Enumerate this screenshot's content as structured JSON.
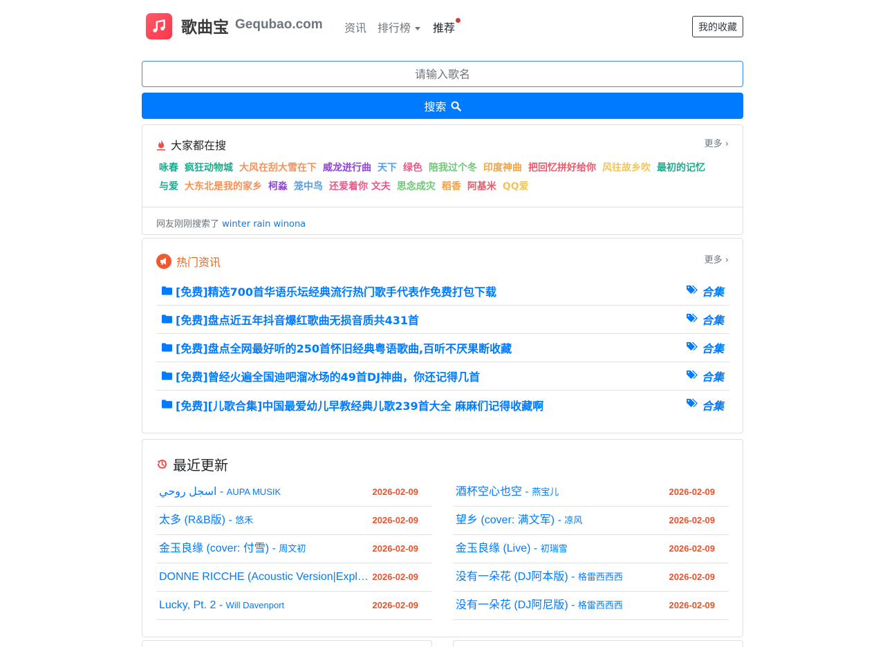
{
  "header": {
    "brand_cn": "歌曲宝",
    "brand_en": "Gequbao.com",
    "nav": {
      "news": "资讯",
      "rank": "排行榜",
      "recommend": "推荐"
    },
    "favorites": "我的收藏"
  },
  "search": {
    "placeholder": "请输入歌名",
    "button": "搜索"
  },
  "hot": {
    "title": "大家都在搜",
    "more": "更多",
    "tags": [
      {
        "text": "咏春",
        "color": "#20a98b"
      },
      {
        "text": "疯狂动物城",
        "color": "#20a98b"
      },
      {
        "text": "大风在刮大雪在下",
        "color": "#f3935a"
      },
      {
        "text": "威龙进行曲",
        "color": "#8e44d6"
      },
      {
        "text": "天下",
        "color": "#5a9ee0"
      },
      {
        "text": "绿色",
        "color": "#ea5a87"
      },
      {
        "text": "陪我过个冬",
        "color": "#6fc777"
      },
      {
        "text": "印度神曲",
        "color": "#f5a142"
      },
      {
        "text": "把回忆拼好给你",
        "color": "#ea5a6b"
      },
      {
        "text": "风往故乡吹",
        "color": "#f3c45a"
      },
      {
        "text": "最初的记忆",
        "color": "#20a98b"
      },
      {
        "text": "与爱",
        "color": "#20a98b"
      },
      {
        "text": "大东北是我的家乡",
        "color": "#f3935a"
      },
      {
        "text": "柯淼",
        "color": "#8e44d6"
      },
      {
        "text": "笼中鸟",
        "color": "#5a9ee0"
      },
      {
        "text": "还爱着你 文夫",
        "color": "#ea5a87"
      },
      {
        "text": "思念成灾",
        "color": "#6fc777"
      },
      {
        "text": "稻香",
        "color": "#f5a142"
      },
      {
        "text": "阿基米",
        "color": "#ea5a6b"
      },
      {
        "text": "QQ爱",
        "color": "#f3c45a"
      }
    ],
    "footer_prefix": "网友刚刚搜索了",
    "footer_latest": "winter rain winona"
  },
  "news": {
    "title": "热门资讯",
    "more": "更多",
    "items": [
      {
        "title": "[免费]精选700首华语乐坛经典流行热门歌手代表作免费打包下载",
        "tag": "合集"
      },
      {
        "title": "[免费]盘点近五年抖音爆红歌曲无损音质共431首",
        "tag": "合集"
      },
      {
        "title": "[免费]盘点全网最好听的250首怀旧经典粤语歌曲,百听不厌果断收藏",
        "tag": "合集"
      },
      {
        "title": "[免费]曾经火遍全国迪吧溜冰场的49首DJ神曲，你还记得几首",
        "tag": "合集"
      },
      {
        "title": "[免费][儿歌合集]中国最爱幼儿早教经典儿歌239首大全 麻麻们记得收藏啊",
        "tag": "合集"
      }
    ]
  },
  "recent": {
    "title": "最近更新",
    "left": [
      {
        "song": "اسجل روحي",
        "artist": "AUPA MUSIK",
        "date": "2026-02-09"
      },
      {
        "song": "太多 (R&B版)",
        "artist": "悠禾",
        "date": "2026-02-09"
      },
      {
        "song": "金玉良缘 (cover: 付雪)",
        "artist": "周文初",
        "date": "2026-02-09"
      },
      {
        "song": "DONNE RICCHE (Acoustic Version|Explicit)",
        "artist": "",
        "date": "2026-02-09"
      },
      {
        "song": "Lucky, Pt. 2",
        "artist": "Will Davenport",
        "date": "2026-02-09"
      }
    ],
    "right": [
      {
        "song": "酒杯空心也空",
        "artist": "燕宝儿",
        "date": "2026-02-09"
      },
      {
        "song": "望乡 (cover: 满文军)",
        "artist": "凉风",
        "date": "2026-02-09"
      },
      {
        "song": "金玉良缘 (Live)",
        "artist": "初瑞雪",
        "date": "2026-02-09"
      },
      {
        "song": "没有一朵花 (DJ阿本版)",
        "artist": "格雷西西西",
        "date": "2026-02-09"
      },
      {
        "song": "没有一朵花 (DJ阿尼版)",
        "artist": "格雷西西西",
        "date": "2026-02-09"
      }
    ]
  },
  "colors": {
    "primary": "#007bff",
    "news_title": "#e8681e",
    "date": "#e8522c",
    "brand_red": "#f7374a"
  }
}
